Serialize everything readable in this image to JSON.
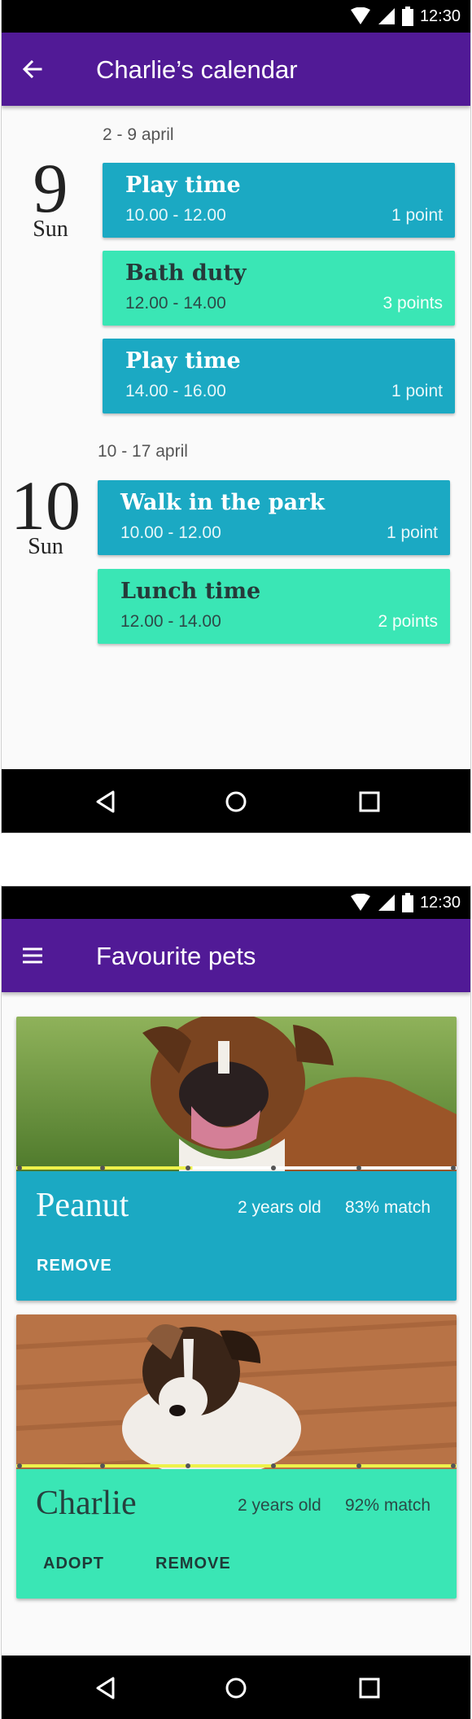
{
  "status": {
    "time": "12:30"
  },
  "calendar": {
    "title": "Charlie’s calendar",
    "weeks": [
      {
        "range": "2 - 9 april",
        "day_number": "9",
        "day_name": "Sun",
        "events": [
          {
            "title": "Play time",
            "time": "10.00 - 12.00",
            "points": "1 point",
            "color": "blue"
          },
          {
            "title": "Bath duty",
            "time": "12.00 - 14.00",
            "points": "3 points",
            "color": "green"
          },
          {
            "title": "Play time",
            "time": "14.00 - 16.00",
            "points": "1 point",
            "color": "blue"
          }
        ]
      },
      {
        "range": "10 - 17 april",
        "day_number": "10",
        "day_name": "Sun",
        "events": [
          {
            "title": "Walk in the park",
            "time": "10.00 - 12.00",
            "points": "1 point",
            "color": "blue"
          },
          {
            "title": "Lunch time",
            "time": "12.00 - 14.00",
            "points": "2 points",
            "color": "green"
          }
        ]
      }
    ]
  },
  "pets_screen": {
    "title": "Favourite pets",
    "pets": [
      {
        "name": "Peanut",
        "age": "2 years old",
        "match": "83% match",
        "rating_fraction": 0.4,
        "actions": [
          "REMOVE"
        ],
        "photo": "boxer-dog-photo"
      },
      {
        "name": "Charlie",
        "age": "2 years old",
        "match": "92% match",
        "rating_fraction": 1.0,
        "actions": [
          "ADOPT",
          "REMOVE"
        ],
        "photo": "jack-russell-photo"
      }
    ]
  },
  "colors": {
    "appbar": "#511a96",
    "card_blue": "#1ba9c3",
    "card_green": "#3ae6b5",
    "rating_fill": "#eef24a"
  },
  "icons": {
    "back": "arrow-back-icon",
    "menu": "hamburger-menu-icon",
    "nav_back": "triangle-back-icon",
    "nav_home": "circle-home-icon",
    "nav_recent": "square-recents-icon"
  }
}
